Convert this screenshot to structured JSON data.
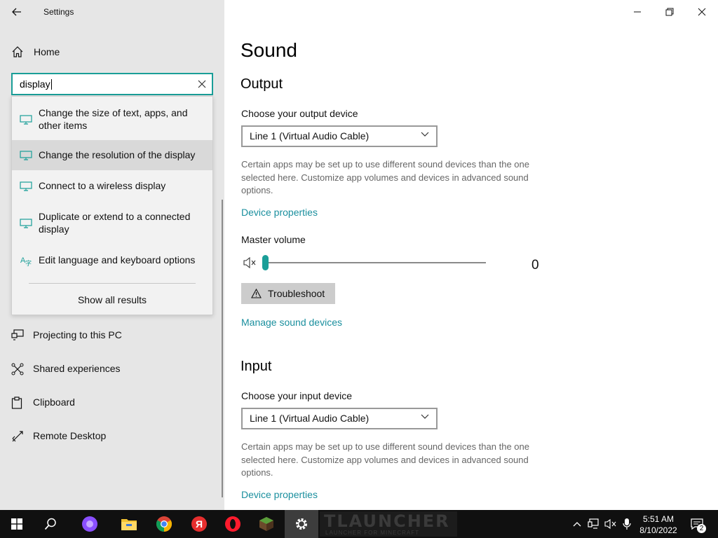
{
  "window": {
    "title": "Settings"
  },
  "sidebar": {
    "home_label": "Home",
    "search": {
      "value": "display"
    },
    "suggestions": [
      {
        "label": "Change the size of text, apps, and other items",
        "icon": "monitor-icon"
      },
      {
        "label": "Change the resolution of the display",
        "icon": "monitor-icon",
        "highlighted": true
      },
      {
        "label": "Connect to a wireless display",
        "icon": "monitor-icon"
      },
      {
        "label": "Duplicate or extend to a connected display",
        "icon": "monitor-icon"
      },
      {
        "label": "Edit language and keyboard options",
        "icon": "language-icon"
      }
    ],
    "show_all_label": "Show all results",
    "nav_items": [
      {
        "label": "Projecting to this PC",
        "icon": "projecting-icon"
      },
      {
        "label": "Shared experiences",
        "icon": "shared-experiences-icon"
      },
      {
        "label": "Clipboard",
        "icon": "clipboard-icon"
      },
      {
        "label": "Remote Desktop",
        "icon": "remote-desktop-icon"
      }
    ]
  },
  "main": {
    "title": "Sound",
    "output": {
      "heading": "Output",
      "device_label": "Choose your output device",
      "device_value": "Line 1 (Virtual Audio Cable)",
      "description": "Certain apps may be set up to use different sound devices than the one selected here. Customize app volumes and devices in advanced sound options.",
      "device_properties_link": "Device properties",
      "master_volume_label": "Master volume",
      "master_volume_value": "0",
      "troubleshoot_label": "Troubleshoot",
      "manage_link": "Manage sound devices"
    },
    "input": {
      "heading": "Input",
      "device_label": "Choose your input device",
      "device_value": "Line 1 (Virtual Audio Cable)",
      "description": "Certain apps may be set up to use different sound devices than the one selected here. Customize app volumes and devices in advanced sound options.",
      "device_properties_link": "Device properties"
    }
  },
  "taskbar": {
    "watermark_text": "TLAUNCHER",
    "watermark_subtext": "LAUNCHER FOR MINECRAFT",
    "clock_time": "5:51 AM",
    "clock_date": "8/10/2022",
    "notification_count": "2"
  },
  "colors": {
    "accent": "#1a9e98",
    "link": "#1a8f9e",
    "sidebar_bg": "#e6e6e6",
    "taskbar_bg": "#101010"
  }
}
